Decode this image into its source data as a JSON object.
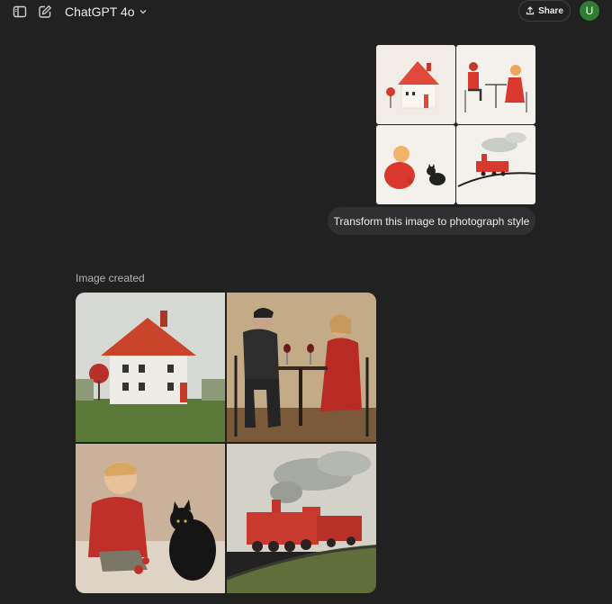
{
  "header": {
    "model_name": "ChatGPT 4o",
    "share_label": "Share",
    "avatar_initial": "U"
  },
  "icons": {
    "sidebar_toggle": "sidebar-toggle-icon",
    "new_chat": "edit-icon",
    "model_dropdown": "chevron-down-icon",
    "share": "share-upload-icon"
  },
  "conversation": {
    "user_images": [
      {
        "subject": "house-illustration"
      },
      {
        "subject": "couple-dining-illustration"
      },
      {
        "subject": "child-and-cat-illustration"
      },
      {
        "subject": "train-illustration"
      }
    ],
    "user_message": "Transform this image to photograph style",
    "assistant_status": "Image created",
    "result_images": [
      {
        "subject": "house-photo"
      },
      {
        "subject": "couple-dining-photo"
      },
      {
        "subject": "child-and-cat-photo"
      },
      {
        "subject": "train-photo"
      }
    ]
  },
  "colors": {
    "background": "#212121",
    "bubble": "#303030",
    "avatar": "#2e7d32",
    "accent_red": "#d9382e"
  }
}
